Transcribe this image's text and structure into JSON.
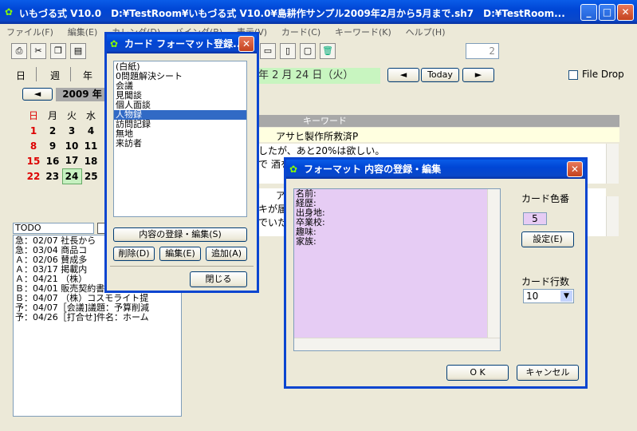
{
  "app": {
    "title": "いもづる式 V10.0　D:¥TestRoom¥いもづる式 V10.0¥島耕作サンプル2009年2月から5月まで.sh7　D:¥TestRoom...",
    "min": "_",
    "max": "□",
    "close": "✕"
  },
  "menu": [
    "ファイル(F)",
    "編集(E)",
    "カレンダ(D)",
    "バインダ(B)",
    "表示(V)",
    "カード(C)",
    "キーワード(K)",
    "ヘルプ(H)"
  ],
  "toolbar": {
    "page_field": "2",
    "icons": [
      "printer-icon",
      "scissors-icon",
      "copy-icon",
      "paste-icon"
    ],
    "trash_icon": "trash-icon"
  },
  "view_tabs": [
    "日",
    "週",
    "年"
  ],
  "date_heading": "年 2 月 24 日（火）",
  "today_button": "Today",
  "file_drop": "File Drop",
  "calendar": {
    "year_month": "2009 年",
    "weekdays": [
      "日",
      "月",
      "火",
      "水"
    ],
    "rows": [
      [
        "1",
        "2",
        "3",
        "4"
      ],
      [
        "8",
        "9",
        "10",
        "11"
      ],
      [
        "15",
        "16",
        "17",
        "18"
      ],
      [
        "22",
        "23",
        "24",
        "25"
      ]
    ],
    "today": "24"
  },
  "keyword_header": "キーワード",
  "keyword_value": "アサヒ製作所救済P",
  "note_lines": [
    "したが、あと20%は欲しい。",
    "で 酒を"
  ],
  "note2_lines": [
    "ア",
    "キが届",
    "でいた"
  ],
  "todo": {
    "title": "TODO",
    "items": [
      "急：02/07 社長から",
      "急：03/04 商品コ",
      "Ａ：02/06 賛成多",
      "Ａ：03/17 掲載内",
      "Ａ：04/21 （株）",
      "Ｂ：04/01 販売契約書原案作成",
      "Ｂ：04/07 （株）コスモライト提",
      "予：04/07［会議]議題：予算削減",
      "予：04/26［打合せ]件名：ホーム"
    ]
  },
  "card_dialog": {
    "title": "カード フォーマット登録...",
    "items": [
      "(白紙)",
      "0問題解決シート",
      "会議",
      "見聞談",
      "個人面談",
      "人物録",
      "訪問記録",
      "無地",
      "来訪者"
    ],
    "selected_index": 5,
    "edit_button": "内容の登録・編集(S)",
    "delete_button": "削除(D)",
    "modify_button": "編集(E)",
    "add_button": "追加(A)",
    "close_button": "閉じる"
  },
  "format_dialog": {
    "title": "フォーマット 内容の登録・編集",
    "lines": [
      "名前:",
      "経歴:",
      "出身地:",
      "卒業校:",
      "趣味:",
      "家族:"
    ],
    "color_label": "カード色番",
    "color_value": "5",
    "settings_button": "設定(E)",
    "rows_label": "カード行数",
    "rows_value": "10",
    "ok_button": "O K",
    "cancel_button": "キャンセル",
    "bg_color": "#e6ccf4"
  }
}
